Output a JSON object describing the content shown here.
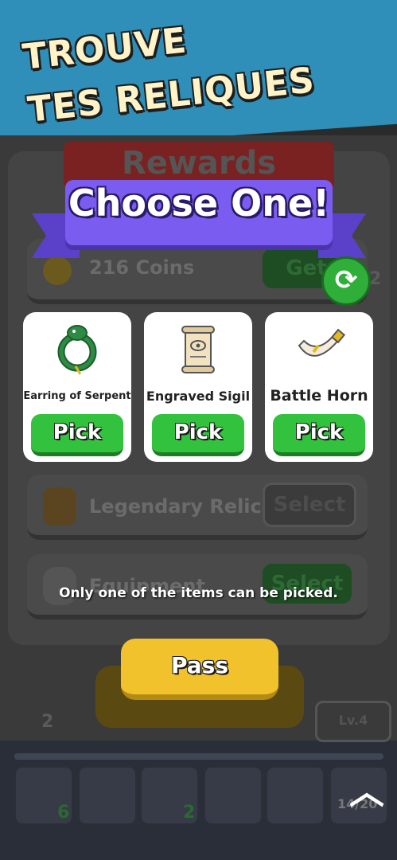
{
  "banner": {
    "line1": "TROUVE",
    "line2": "TES RELIQUES"
  },
  "background": {
    "rewards_header": "Rewards",
    "coins_row": {
      "label": "216 Coins",
      "button": "Get",
      "count": "2"
    },
    "relic_row": {
      "label": "Legendary Relic",
      "button": "Select"
    },
    "equipment_row": {
      "label": "Equipment",
      "button": "Select"
    },
    "level": "Lv.4",
    "attack_stat": "2",
    "progress": "14/20",
    "slot_counts": [
      "6",
      "2"
    ]
  },
  "dialog": {
    "title": "Choose One!",
    "cards": [
      {
        "name": "Earring of Serpent",
        "button": "Pick",
        "icon": "serpent-earring-icon"
      },
      {
        "name": "Engraved Sigil",
        "button": "Pick",
        "icon": "scroll-sigil-icon"
      },
      {
        "name": "Battle Horn",
        "button": "Pick",
        "icon": "battle-horn-icon"
      }
    ],
    "hint": "Only one of the items can be picked.",
    "pass_button": "Pass"
  },
  "colors": {
    "banner": "#2f8fb8",
    "ribbon": "#7b5cf0",
    "pick": "#33c23d",
    "pass": "#f2c22d"
  }
}
